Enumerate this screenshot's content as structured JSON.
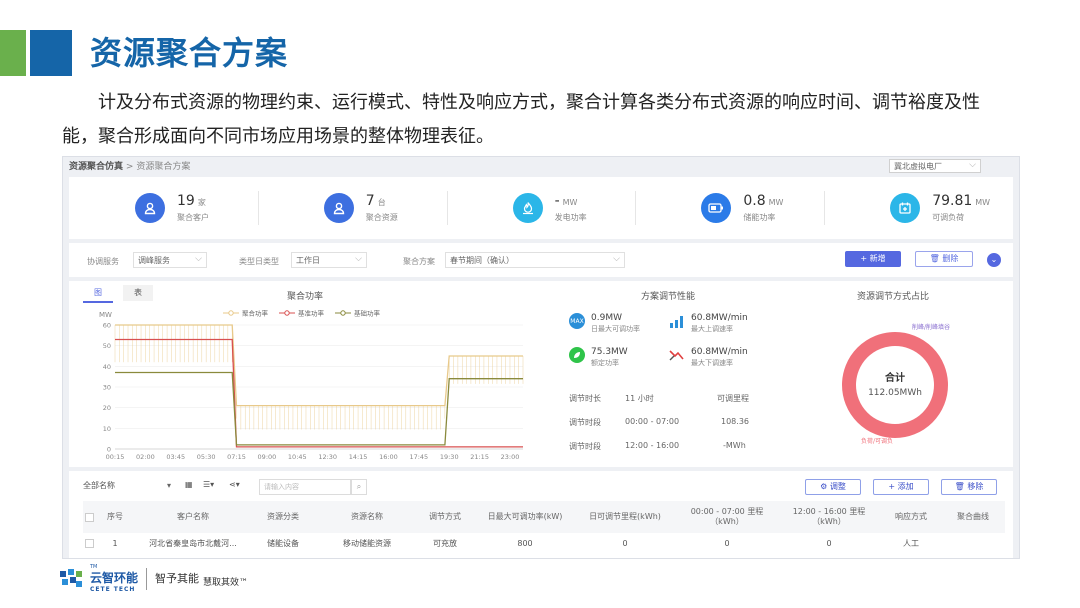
{
  "slide": {
    "title": "资源聚合方案",
    "body": "计及分布式资源的物理约束、运行模式、特性及响应方式，聚合计算各类分布式资源的响应时间、调节裕度及性能，聚合形成面向不同市场应用场景的整体物理表征。"
  },
  "app": {
    "breadcrumb_root": "资源聚合仿真",
    "breadcrumb_sep": ">",
    "breadcrumb_current": "资源聚合方案",
    "plant_selector": "冀北虚拟电厂",
    "stats": [
      {
        "value": "19",
        "unit": "家",
        "label": "聚合客户",
        "icon": "user-icon",
        "color": "#3d6fe0"
      },
      {
        "value": "7",
        "unit": "台",
        "label": "聚合资源",
        "icon": "user-icon",
        "color": "#3d6fe0"
      },
      {
        "value": "-",
        "unit": "MW",
        "label": "发电功率",
        "icon": "flame-icon",
        "color": "#2bb6e8"
      },
      {
        "value": "0.8",
        "unit": "MW",
        "label": "储能功率",
        "icon": "battery-icon",
        "color": "#2b7be8"
      },
      {
        "value": "79.81",
        "unit": "MW",
        "label": "可调负荷",
        "icon": "calendar-plus-icon",
        "color": "#2bb6e8"
      }
    ],
    "filter": {
      "service_label": "协调服务",
      "service_value": "调峰服务",
      "daytype_label": "类型日类型",
      "daytype_value": "工作日",
      "scheme_label": "聚合方案",
      "scheme_value": "春节期间（确认）",
      "new_button": "+ 新增",
      "delete_button": "删除"
    },
    "tabs": {
      "chart": "图",
      "table": "表"
    },
    "panel_titles": {
      "power": "聚合功率",
      "performance": "方案调节性能",
      "ratio": "资源调节方式占比"
    },
    "performance": {
      "items": [
        {
          "value": "0.9MW",
          "label": "日最大可调功率",
          "icon": "max-icon",
          "icon_text": "MAX",
          "color": "#2b8fd8"
        },
        {
          "value": "60.8MW/min",
          "label": "最大上调速率",
          "icon": "bar-up-icon",
          "icon_text": "",
          "color": "#2b8fd8"
        },
        {
          "value": "75.3MW",
          "label": "额定功率",
          "icon": "leaf-icon",
          "icon_text": "",
          "color": "#2fc44a"
        },
        {
          "value": "60.8MW/min",
          "label": "最大下调速率",
          "icon": "trend-down-icon",
          "icon_text": "",
          "color": "#e04040"
        }
      ],
      "rows": [
        {
          "k": "调节时长",
          "v": "11 小时",
          "v2": "可调里程"
        },
        {
          "k": "调节时段",
          "v": "00:00 - 07:00",
          "v2": "108.36"
        },
        {
          "k": "调节时段",
          "v": "12:00 - 16:00",
          "v2": "-MWh"
        }
      ]
    },
    "donut": {
      "center_label": "合计",
      "center_value": "112.05MWh",
      "legend_a": "削峰/削峰填谷",
      "legend_b": "负荷/可调负",
      "color": "#f0707a"
    },
    "table": {
      "selector": "全部名称",
      "search_placeholder": "请输入内容",
      "buttons": {
        "adjust": "调整",
        "add": "+ 添加",
        "remove": "移除"
      },
      "headers": [
        "序号",
        "客户名称",
        "资源分类",
        "资源名称",
        "调节方式",
        "日最大可调功率(kW)",
        "日可调节里程(kWh)",
        "00:00 - 07:00 里程（kWh）",
        "12:00 - 16:00 里程（kWh）",
        "响应方式",
        "聚合曲线"
      ],
      "rows": [
        [
          "1",
          "河北省秦皇岛市北戴河...",
          "储能设备",
          "移动储能资源",
          "可充放",
          "800",
          "0",
          "0",
          "0",
          "人工",
          ""
        ]
      ]
    }
  },
  "chart_data": {
    "type": "line",
    "title": "聚合功率",
    "ylabel": "MW",
    "ylim": [
      0,
      60
    ],
    "yticks": [
      0,
      10,
      20,
      30,
      40,
      50,
      60
    ],
    "xticks": [
      "00:15",
      "02:00",
      "03:45",
      "05:30",
      "07:15",
      "09:00",
      "10:45",
      "12:30",
      "14:15",
      "16:00",
      "17:45",
      "19:30",
      "21:15",
      "23:00"
    ],
    "series": [
      {
        "name": "聚合功率",
        "color": "#e8c98a",
        "points": [
          [
            0.25,
            60
          ],
          [
            7.0,
            60
          ],
          [
            7.25,
            21
          ],
          [
            19.25,
            21
          ],
          [
            19.5,
            45
          ],
          [
            23.75,
            45
          ]
        ]
      },
      {
        "name": "基准功率",
        "color": "#d85050",
        "points": [
          [
            0.25,
            53
          ],
          [
            7.0,
            53
          ],
          [
            7.25,
            1
          ],
          [
            23.75,
            1
          ]
        ]
      },
      {
        "name": "基础功率",
        "color": "#8a8a3c",
        "points": [
          [
            0.25,
            37
          ],
          [
            7.0,
            37
          ],
          [
            7.25,
            2
          ],
          [
            19.25,
            2
          ],
          [
            19.5,
            34
          ],
          [
            23.75,
            34
          ]
        ]
      }
    ],
    "legend": "top"
  },
  "footer": {
    "logo_cn": "云智环能",
    "logo_en": "CETE TECH",
    "tm": "TM",
    "slogan1": "智予其能",
    "slogan2": "慧取其效™"
  }
}
